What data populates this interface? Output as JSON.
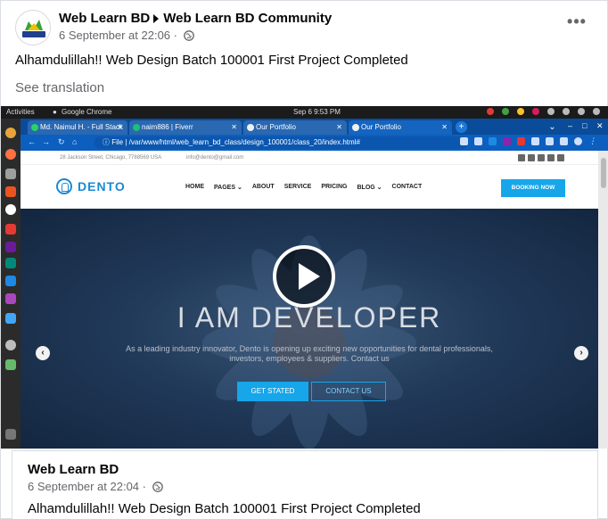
{
  "post": {
    "page_name": "Web Learn BD",
    "group_name": "Web Learn BD Community",
    "timestamp": "6 September at 22:06",
    "caption": "Alhamdulillah!! Web Design Batch 100001 First Project Completed",
    "see_translation": "See translation",
    "more_label": "•••"
  },
  "desktop": {
    "activities": "Activities",
    "app_name": "Google Chrome",
    "clock": "Sep 6  9:53 PM"
  },
  "browser": {
    "tabs": [
      {
        "label": "Md. Naimul H. - Full Stack",
        "color": "#25d366"
      },
      {
        "label": "naim886 | Fiverr",
        "color": "#1dbf73"
      },
      {
        "label": "Our Portfolio",
        "color": "#f0f0f0"
      },
      {
        "label": "Our Portfolio",
        "color": "#f0f0f0"
      }
    ],
    "new_tab": "+",
    "url_prefix": "File",
    "url": "/var/www/html/web_learn_bd_class/design_100001/class_20/index.html#"
  },
  "site": {
    "address": "28 Jackson Street, Chicago, 7788569 USA",
    "email": "info@dento@gmail.com",
    "brand": "DENTO",
    "menu": [
      "HOME",
      "PAGES",
      "ABOUT",
      "SERVICE",
      "PRICING",
      "BLOG",
      "CONTACT"
    ],
    "booking": "BOOKING NOW",
    "hero_title": "I AM DEVELOPER",
    "hero_sub": "As a leading industry innovator, Dento is opening up exciting new opportunities for dental professionals, investors, employees & suppliers. Contact us",
    "btn_get": "GET STATED",
    "btn_contact": "CONTACT US"
  },
  "shared": {
    "name": "Web Learn BD",
    "timestamp": "6 September at 22:04",
    "caption": "Alhamdulillah!! Web Design Batch 100001 First Project Completed"
  },
  "colors": {
    "accent": "#16a6e9",
    "chrome_blue": "#0d5fbf",
    "meta_gray": "#65676b"
  }
}
